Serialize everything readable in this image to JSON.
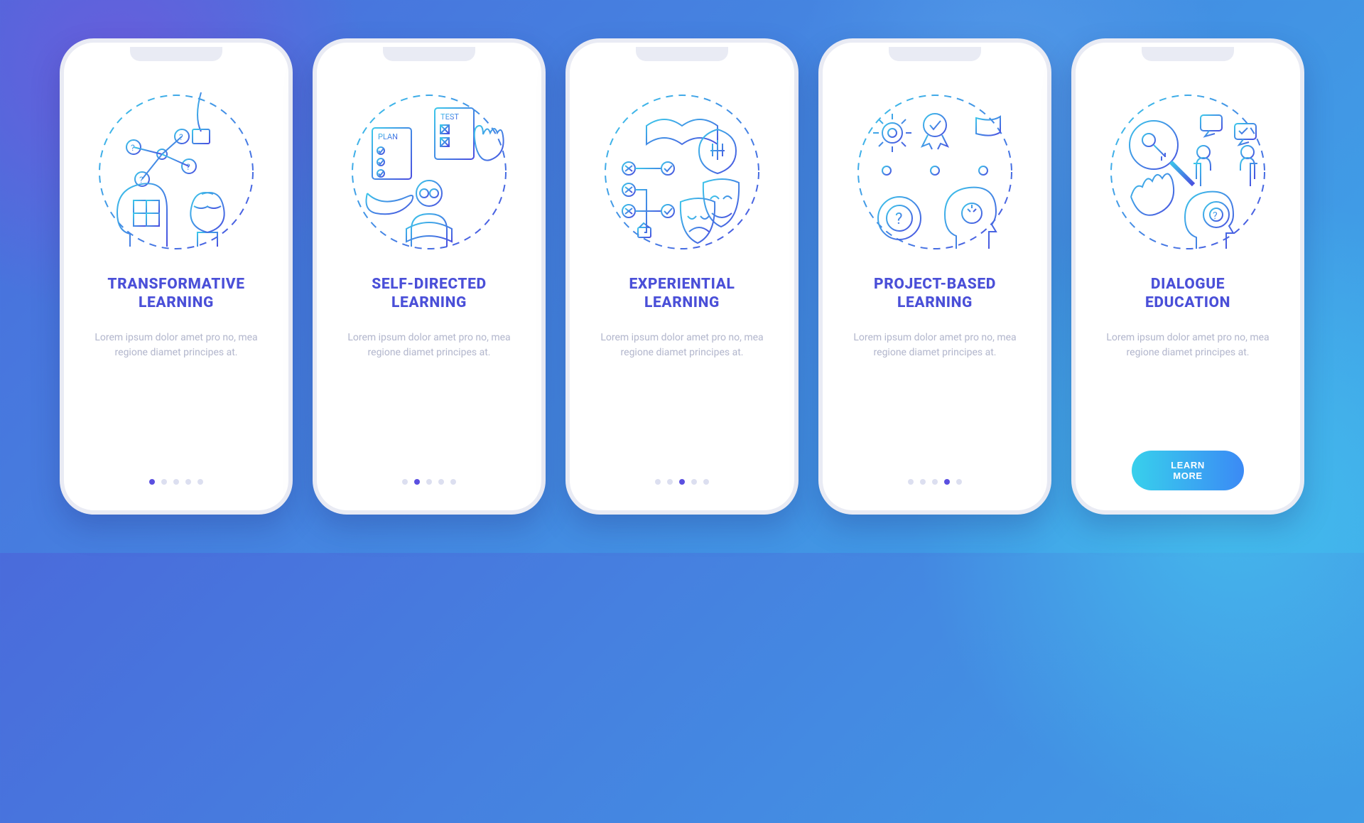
{
  "placeholder": "Lorem ipsum dolor amet pro no, mea regione diamet principes at.",
  "cta_label": "LEARN MORE",
  "total_dots": 5,
  "cards": [
    {
      "title": "TRANSFORMATIVE\nLEARNING",
      "active_dot": 0
    },
    {
      "title": "SELF-DIRECTED\nLEARNING",
      "active_dot": 1
    },
    {
      "title": "EXPERIENTIAL\nLEARNING",
      "active_dot": 2
    },
    {
      "title": "PROJECT-BASED\nLEARNING",
      "active_dot": 3
    },
    {
      "title": "DIALOGUE\nEDUCATION",
      "active_dot": 4
    }
  ],
  "illustration_labels": {
    "card1_book": "",
    "card2_plan": "PLAN",
    "card2_test": "TEST"
  }
}
